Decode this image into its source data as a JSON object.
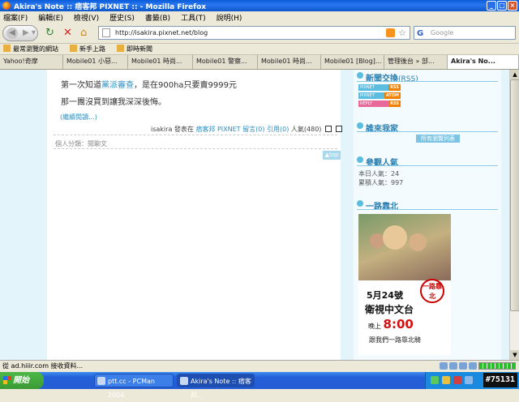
{
  "window": {
    "title": "Akira's Note :: 痞客邦 PIXNET :: - Mozilla Firefox",
    "min": "_",
    "max": "□",
    "close": "×"
  },
  "menu": [
    "檔案(F)",
    "編輯(E)",
    "檢視(V)",
    "歷史(S)",
    "書籤(B)",
    "工具(T)",
    "說明(H)"
  ],
  "nav": {
    "url": "http://isakira.pixnet.net/blog",
    "search_placeholder": "Google"
  },
  "bookmarks": [
    "最常瀏覽的網站",
    "新手上路",
    "即時新聞"
  ],
  "tabs": [
    "Yahoo!奇摩",
    "Mobile01 小惡...",
    "Mobile01 時尚...",
    "Mobile01 警察...",
    "Mobile01 時尚...",
    "Mobile01 [Blog]...",
    "管理後台 » 部...",
    "Akira's No..."
  ],
  "post": {
    "line1_before": "第一次知道",
    "line1_link": "黨派審查",
    "line1_after": "，是在900ha只要賣9999元",
    "line2": "那一團沒買到讓我深深後悔。",
    "read_more": "(繼續閱讀...)",
    "author": "isakira",
    "posted_in": "發表在",
    "site": "痞客邦 PIXNET",
    "comments": "留言(0)",
    "trackback": "引用(0)",
    "popularity": "人氣(480)",
    "category": "個人分類：閒聊文",
    "to_top": "▲top"
  },
  "sidebar": {
    "links_title": "新聞交換",
    "links_sub": "(RSS)",
    "rss_buttons": [
      {
        "label": "PIXNET",
        "tag": "RSS"
      },
      {
        "label": "PIXNET",
        "tag": "ATOM"
      },
      {
        "label": "REPLY",
        "tag": "RSS"
      }
    ],
    "visitors_title": "誰來我家",
    "visitors_button": "所有瀏覽列表",
    "stats_title": "參觀人氣",
    "today": "本日人氣：24",
    "total": "累積人氣：997",
    "ad_title": "一路靠北",
    "ad_date": "5月24號",
    "ad_logo": "一路靠北",
    "ad_channel": "衛視中文台",
    "ad_time_prefix": "晚上",
    "ad_time": "8:00",
    "ad_sub": "跟我們一路靠北騎"
  },
  "status": {
    "text": "從 ad.hiiir.com 接收資料..."
  },
  "taskbar": {
    "start": "開始",
    "tasks": [
      "ptt.cc - PCMan 2004",
      "Akira's Note :: 痞客邦..."
    ],
    "clock": "#75131"
  },
  "colors": {
    "link": "#2a8fbf",
    "sidebar_accent": "#2a7fb0",
    "side_bg": "#e4f4fb"
  }
}
